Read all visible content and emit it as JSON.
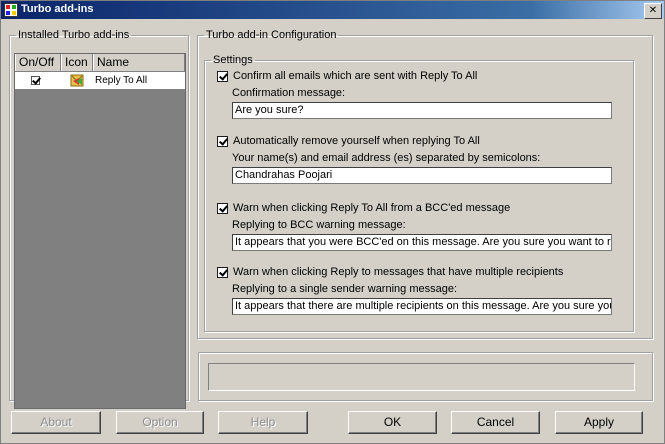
{
  "window": {
    "title": "Turbo add-ins",
    "close_label": "✕"
  },
  "installed": {
    "legend": "Installed Turbo add-ins",
    "columns": [
      "On/Off",
      "Icon",
      "Name"
    ],
    "rows": [
      {
        "checked": true,
        "icon": "reply-all-icon",
        "name": "Reply To All"
      }
    ]
  },
  "config": {
    "legend": "Turbo add-in Configuration",
    "settings_legend": "Settings",
    "options": [
      {
        "label": "Confirm all emails which are sent with Reply To All",
        "checked": true,
        "sub_label": "Confirmation message:",
        "value": "Are you sure?"
      },
      {
        "label": "Automatically remove yourself when replying To All",
        "checked": true,
        "sub_label": "Your name(s) and email address (es) separated by semicolons:",
        "value": "Chandrahas Poojari"
      },
      {
        "label": "Warn when clicking Reply To All from a BCC'ed message",
        "checked": true,
        "sub_label": "Replying to BCC warning message:",
        "value": "It appears that you were BCC'ed on this message.  Are you sure you want to reply t"
      },
      {
        "label": "Warn when clicking Reply to messages that have multiple recipients",
        "checked": true,
        "sub_label": "Replying to a single sender warning message:",
        "value": "It appears that there are multiple recipients on this message.  Are you sure you war"
      }
    ]
  },
  "buttons": {
    "about": "About",
    "option": "Option",
    "help": "Help",
    "ok": "OK",
    "cancel": "Cancel",
    "apply": "Apply"
  }
}
